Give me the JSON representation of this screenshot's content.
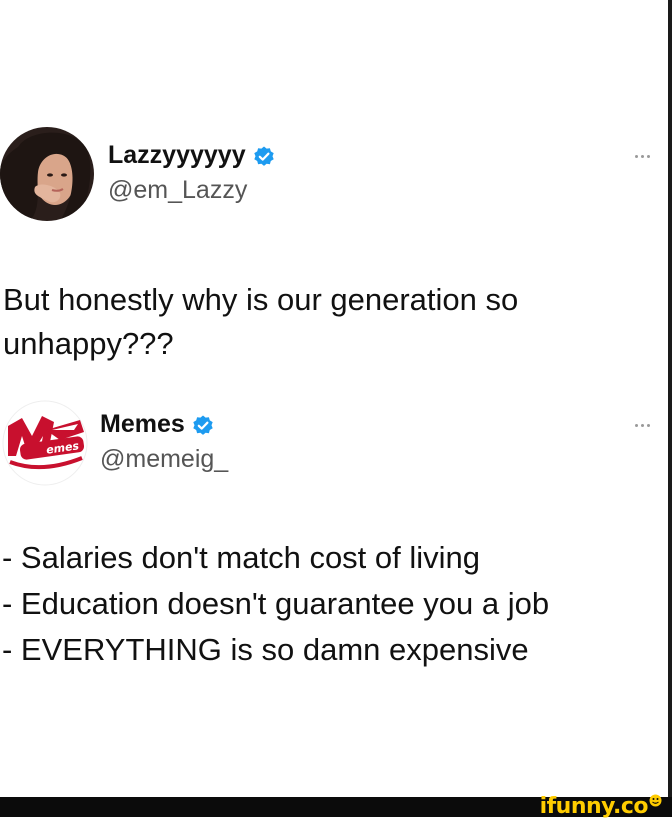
{
  "tweets": [
    {
      "display_name": "Lazzyyyyyy",
      "handle": "@em_Lazzy",
      "verified": true,
      "avatar": "profile-photo",
      "text": "But honestly why is our generation so\nunhappy???"
    },
    {
      "display_name": "Memes",
      "handle": "@memeig_",
      "verified": true,
      "avatar": "memes-logo",
      "text": "- Salaries don't match cost of living\n- Education doesn't guarantee you a job\n- EVERYTHING is so damn expensive"
    }
  ],
  "watermark": {
    "text": "ifunny.co",
    "color": "#ffcc00"
  },
  "colors": {
    "verified": "#1d9bf0",
    "memes_logo": "#c8102e"
  }
}
